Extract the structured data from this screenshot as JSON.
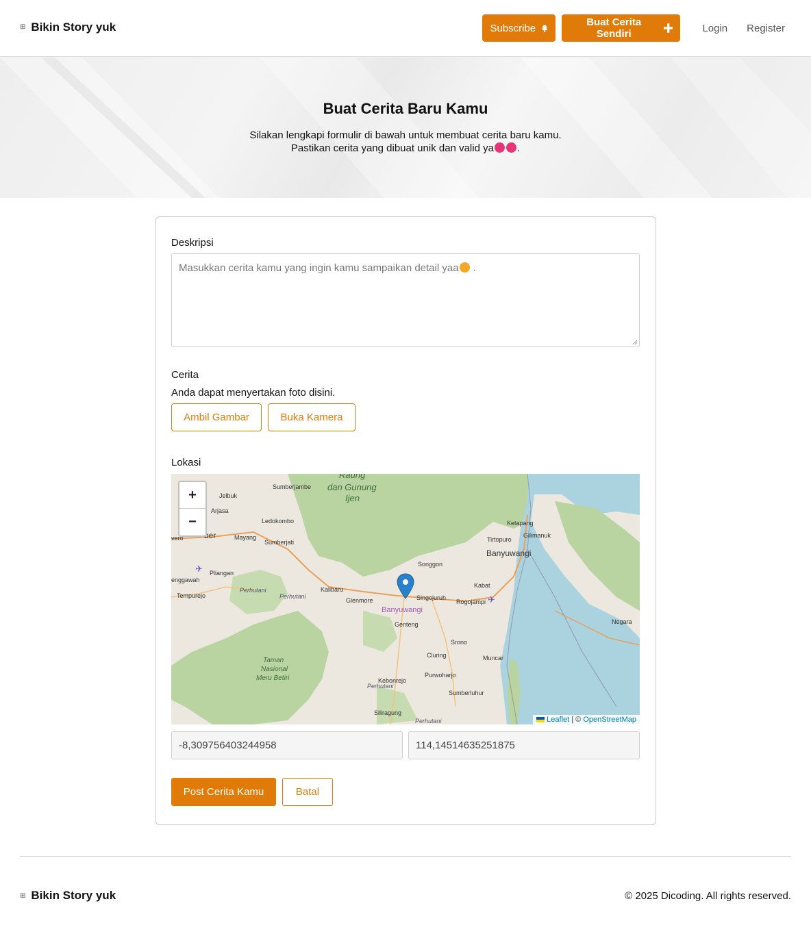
{
  "header": {
    "brand_icon": "grid-icon",
    "brand": "Bikin Story yuk",
    "subscribe_label": "Subscribe",
    "subscribe_icon": "bell-icon",
    "buat_label": "Buat Cerita Sendiri",
    "buat_icon": "plus-icon",
    "login_label": "Login",
    "register_label": "Register"
  },
  "hero": {
    "title": "Buat Cerita Baru Kamu",
    "line1": "Silakan lengkapi formulir di bawah untuk membuat cerita baru kamu.",
    "line2": "Pastikan cerita yang dibuat unik dan valid ya",
    "line2_end": "."
  },
  "form": {
    "deskripsi_label": "Deskripsi",
    "deskripsi_placeholder": "Masukkan cerita kamu yang ingin kamu sampaikan detail yaa",
    "deskripsi_placeholder_end": ".",
    "cerita_label": "Cerita",
    "cerita_sub": "Anda dapat menyertakan foto disini.",
    "ambil_label": "Ambil Gambar",
    "kamera_label": "Buka Kamera",
    "lokasi_label": "Lokasi",
    "latitude": "-8,309756403244958",
    "longitude": "114,14514635251875",
    "post_label": "Post Cerita Kamu",
    "batal_label": "Batal"
  },
  "map": {
    "zoom_in": "+",
    "zoom_out": "−",
    "attribution_leaflet": "Leaflet",
    "attribution_sep": " | © ",
    "attribution_osm": "OpenStreetMap",
    "places": {
      "raung": "Raung",
      "ijen": "dan Gunung",
      "ijen2": "Ijen",
      "sumberjambe": "Sumberjambe",
      "jelbuk": "Jelbuk",
      "arjasa": "Arjasa",
      "ledokombo": "Ledokombo",
      "jember": "ber",
      "vero": "vero",
      "mayang": "Mayang",
      "sumberjati": "Sumberjati",
      "pliangan": "Pliangan",
      "enggawah": "enggawah",
      "tempurejo": "Tempurejo",
      "perhutani1": "Perhutani",
      "perhutani2": "Perhutani",
      "kalibaru": "Kalibaru",
      "glenmore": "Glenmore",
      "songgon": "Songgon",
      "singojuruh": "Singojuruh",
      "banyuwangi_reg": "Banyuwangi",
      "genteng": "Genteng",
      "kabat": "Kabat",
      "rogojampi": "Rogojampi",
      "ketapang": "Ketapang",
      "gilimanuk": "Gilimanuk",
      "tirtopuro": "Tirtopuro",
      "banyuwangi": "Banyuwangi",
      "srono": "Srono",
      "cluring": "Cluring",
      "muncar": "Muncar",
      "taman1": "Taman",
      "taman2": "Nasional",
      "taman3": "Meru Betiri",
      "kebonrejo": "Kebonrejo",
      "perhutani3": "Perhutani",
      "purwoharjo": "Purwoharjo",
      "sumberluhur": "Sumberluhur",
      "siliragung": "Siliragung",
      "perhutani4": "Perhutani",
      "negara": "Negara"
    }
  },
  "footer": {
    "brand_icon": "grid-icon",
    "brand": "Bikin Story yuk",
    "copyright": "© 2025 Dicoding. All rights reserved."
  },
  "colors": {
    "accent": "#e07b0a",
    "map_green": "#b9d3a1",
    "map_sea": "#aad3df"
  }
}
